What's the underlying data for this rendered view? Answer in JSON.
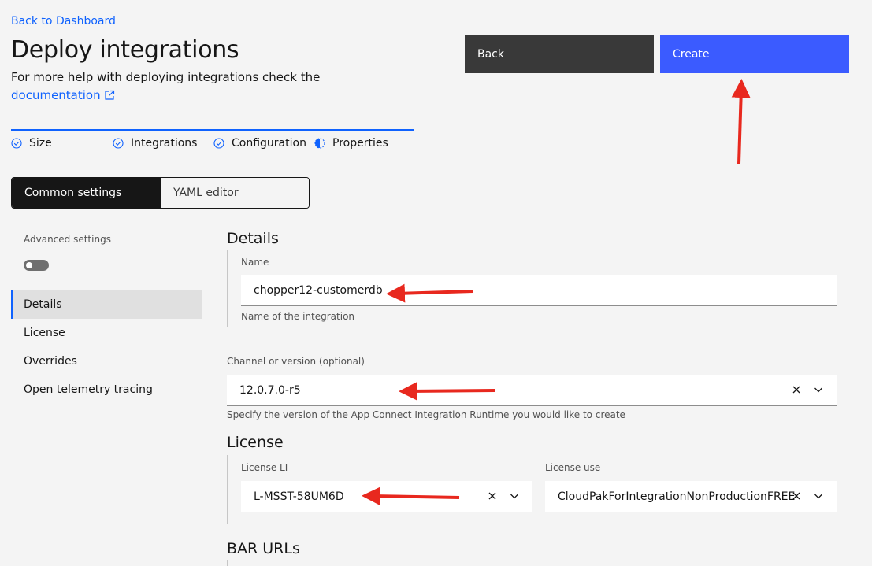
{
  "header": {
    "back_link": "Back to Dashboard",
    "title": "Deploy integrations",
    "help_text": "For more help with deploying integrations check the",
    "doc_link": "documentation"
  },
  "actions": {
    "back_label": "Back",
    "create_label": "Create"
  },
  "progress": {
    "steps": [
      {
        "label": "Size",
        "state": "complete"
      },
      {
        "label": "Integrations",
        "state": "complete"
      },
      {
        "label": "Configuration",
        "state": "complete"
      },
      {
        "label": "Properties",
        "state": "current"
      }
    ]
  },
  "switcher": {
    "tabs": [
      "Common settings",
      "YAML editor"
    ],
    "selected": "Common settings"
  },
  "sidebar": {
    "advanced_label": "Advanced settings",
    "advanced_enabled": false,
    "items": [
      "Details",
      "License",
      "Overrides",
      "Open telemetry tracing"
    ],
    "selected": "Details"
  },
  "details": {
    "title": "Details",
    "name_label": "Name",
    "name_value": "chopper12-customerdb",
    "name_helper": "Name of the integration",
    "channel_label": "Channel or version (optional)",
    "channel_value": "12.0.7.0-r5",
    "channel_helper": "Specify the version of the App Connect Integration Runtime you would like to create"
  },
  "license": {
    "title": "License",
    "li_label": "License LI",
    "li_value": "L-MSST-58UM6D",
    "use_label": "License use",
    "use_value": "CloudPakForIntegrationNonProductionFREE"
  },
  "bar_urls": {
    "title": "BAR URLs"
  },
  "colors": {
    "primary": "#0f62fe",
    "create_button": "#3b5bff",
    "secondary_button": "#393939",
    "annotation_arrow": "#e8281e"
  }
}
